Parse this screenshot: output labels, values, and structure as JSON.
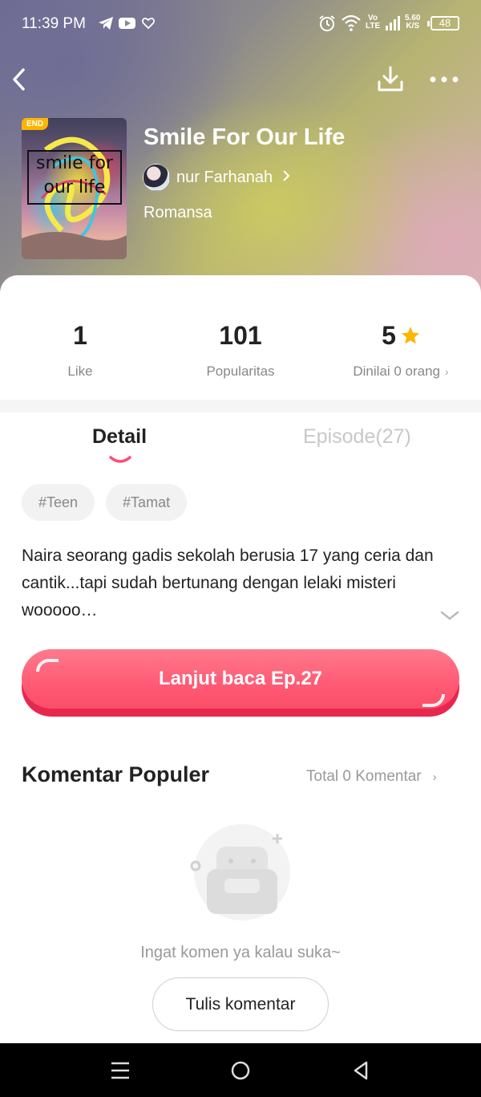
{
  "status_bar": {
    "time": "11:39 PM",
    "volte": [
      "Vo",
      "LTE"
    ],
    "speed": [
      "5.60",
      "K/S"
    ],
    "battery": "48",
    "icons": [
      "telegram-icon",
      "youtube-icon",
      "heart-icon",
      "alarm-icon",
      "wifi-icon",
      "signal-icon",
      "battery-icon"
    ]
  },
  "top_bar": {
    "icons": [
      "back-arrow-icon",
      "download-icon",
      "more-icon"
    ]
  },
  "book": {
    "badge": "END",
    "cover_title_line1": "smile for",
    "cover_title_line2": "our life",
    "title": "Smile For Our Life",
    "author": "nur Farhanah",
    "genre": "Romansa"
  },
  "stats": {
    "like_value": "1",
    "like_label": "Like",
    "popularity_value": "101",
    "popularity_label": "Popularitas",
    "rating_value": "5",
    "rating_label": "Dinilai 0 orang"
  },
  "tabs": {
    "detail": "Detail",
    "episode": "Episode(27)",
    "active": "detail"
  },
  "tags": [
    "#Teen",
    "#Tamat"
  ],
  "description": "Naira seorang gadis sekolah berusia 17 yang ceria dan cantik...tapi sudah bertunang dengan lelaki misteri wooooo…",
  "read_button": "Lanjut baca Ep.27",
  "comments": {
    "title": "Komentar Populer",
    "total": "Total 0 Komentar",
    "empty_text": "Ingat komen ya kalau suka~",
    "write_button": "Tulis komentar"
  },
  "colors": {
    "accent": "#ff5a74",
    "accent_dark": "#e8274f",
    "star": "#ffb400",
    "muted": "#999999"
  }
}
